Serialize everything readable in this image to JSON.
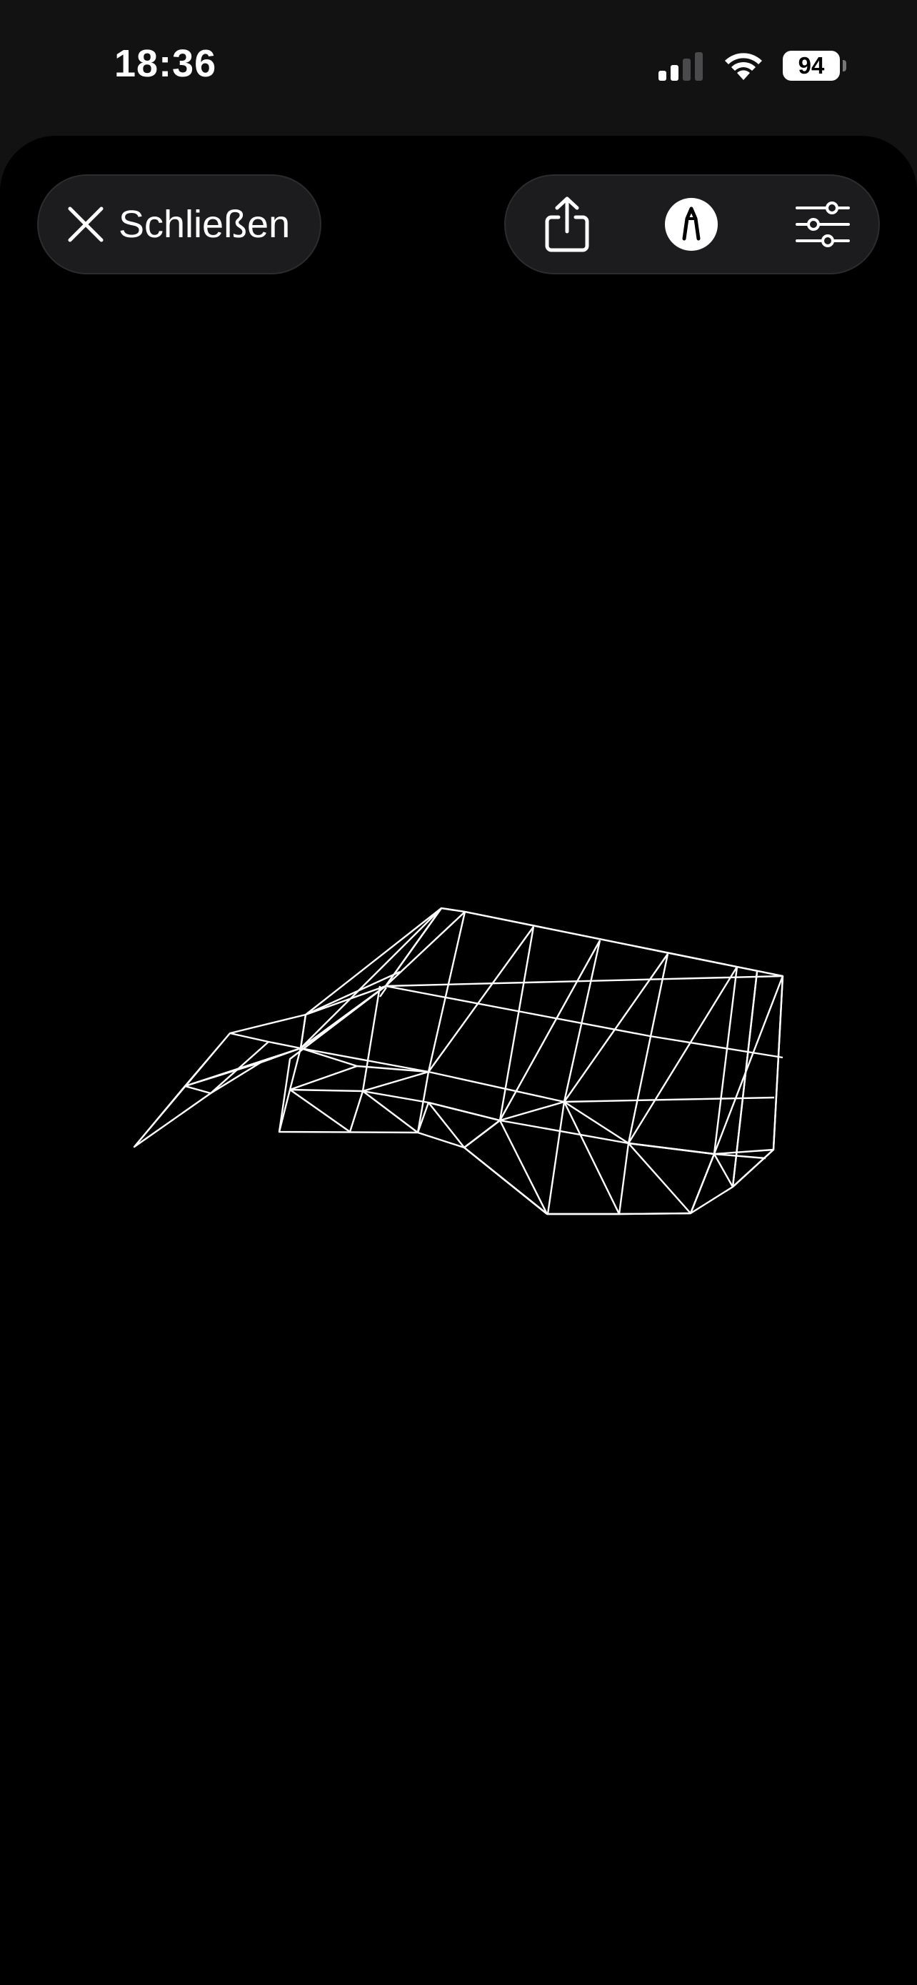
{
  "status_bar": {
    "time": "18:36",
    "battery_level": "94",
    "signal_icon": "cellular-signal-icon",
    "wifi_icon": "wifi-icon"
  },
  "toolbar": {
    "close_label": "Schließen",
    "close_icon": "close-icon",
    "share_icon": "share-icon",
    "markup_icon": "markup-icon",
    "adjust_icon": "sliders-icon"
  },
  "colors": {
    "background": "#000000",
    "status_background": "#121213",
    "pill_background": "#1c1c1e",
    "mesh_stroke": "#ffffff"
  }
}
